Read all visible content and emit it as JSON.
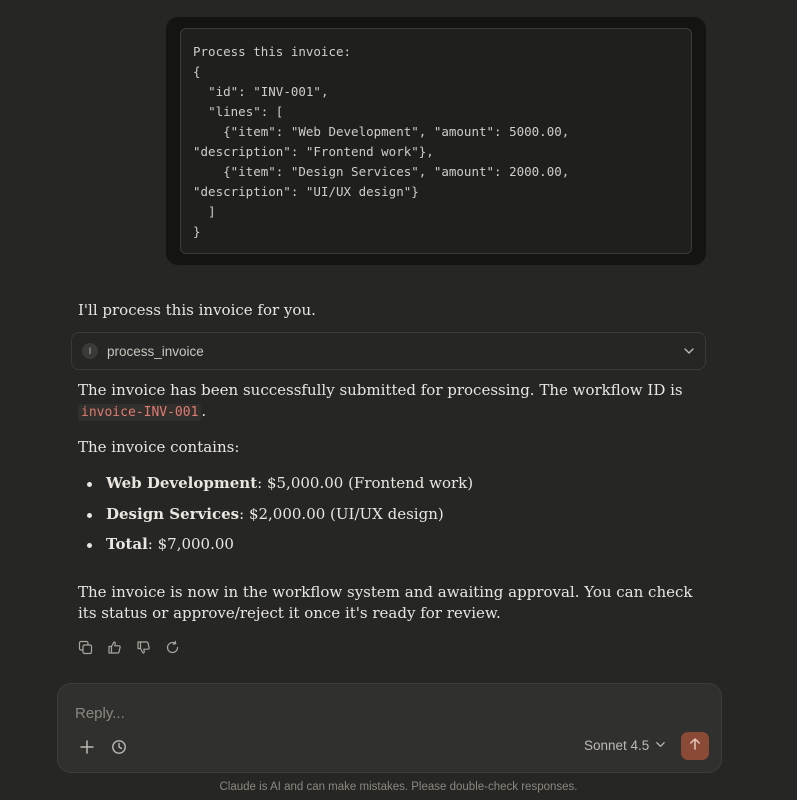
{
  "user_message": {
    "text": "Process this invoice:\n{\n  \"id\": \"INV-001\",\n  \"lines\": [\n    {\"item\": \"Web Development\", \"amount\": 5000.00, \"description\": \"Frontend work\"},\n    {\"item\": \"Design Services\", \"amount\": 2000.00, \"description\": \"UI/UX design\"}\n  ]\n}"
  },
  "assistant": {
    "intro": "I'll process this invoice for you.",
    "tool_call": {
      "badge": "I",
      "name": "process_invoice"
    },
    "para1_prefix": "The invoice has been successfully submitted for processing. The workflow ID is ",
    "workflow_id": "invoice-INV-001",
    "para1_suffix": ".",
    "para2": "The invoice contains:",
    "bullets": [
      {
        "label": "Web Development",
        "text": ": $5,000.00 (Frontend work)"
      },
      {
        "label": "Design Services",
        "text": ": $2,000.00 (UI/UX design)"
      },
      {
        "label": "Total",
        "text": ": $7,000.00"
      }
    ],
    "para3": "The invoice is now in the workflow system and awaiting approval. You can check its status or approve/reject it once it's ready for review."
  },
  "actions": {
    "icons": [
      "copy-icon",
      "thumbs-up-icon",
      "thumbs-down-icon",
      "retry-icon"
    ]
  },
  "composer": {
    "placeholder": "Reply...",
    "model": "Sonnet 4.5",
    "send_color": "#8a4a36"
  },
  "disclaimer": "Claude is AI and can make mistakes. Please double-check responses."
}
